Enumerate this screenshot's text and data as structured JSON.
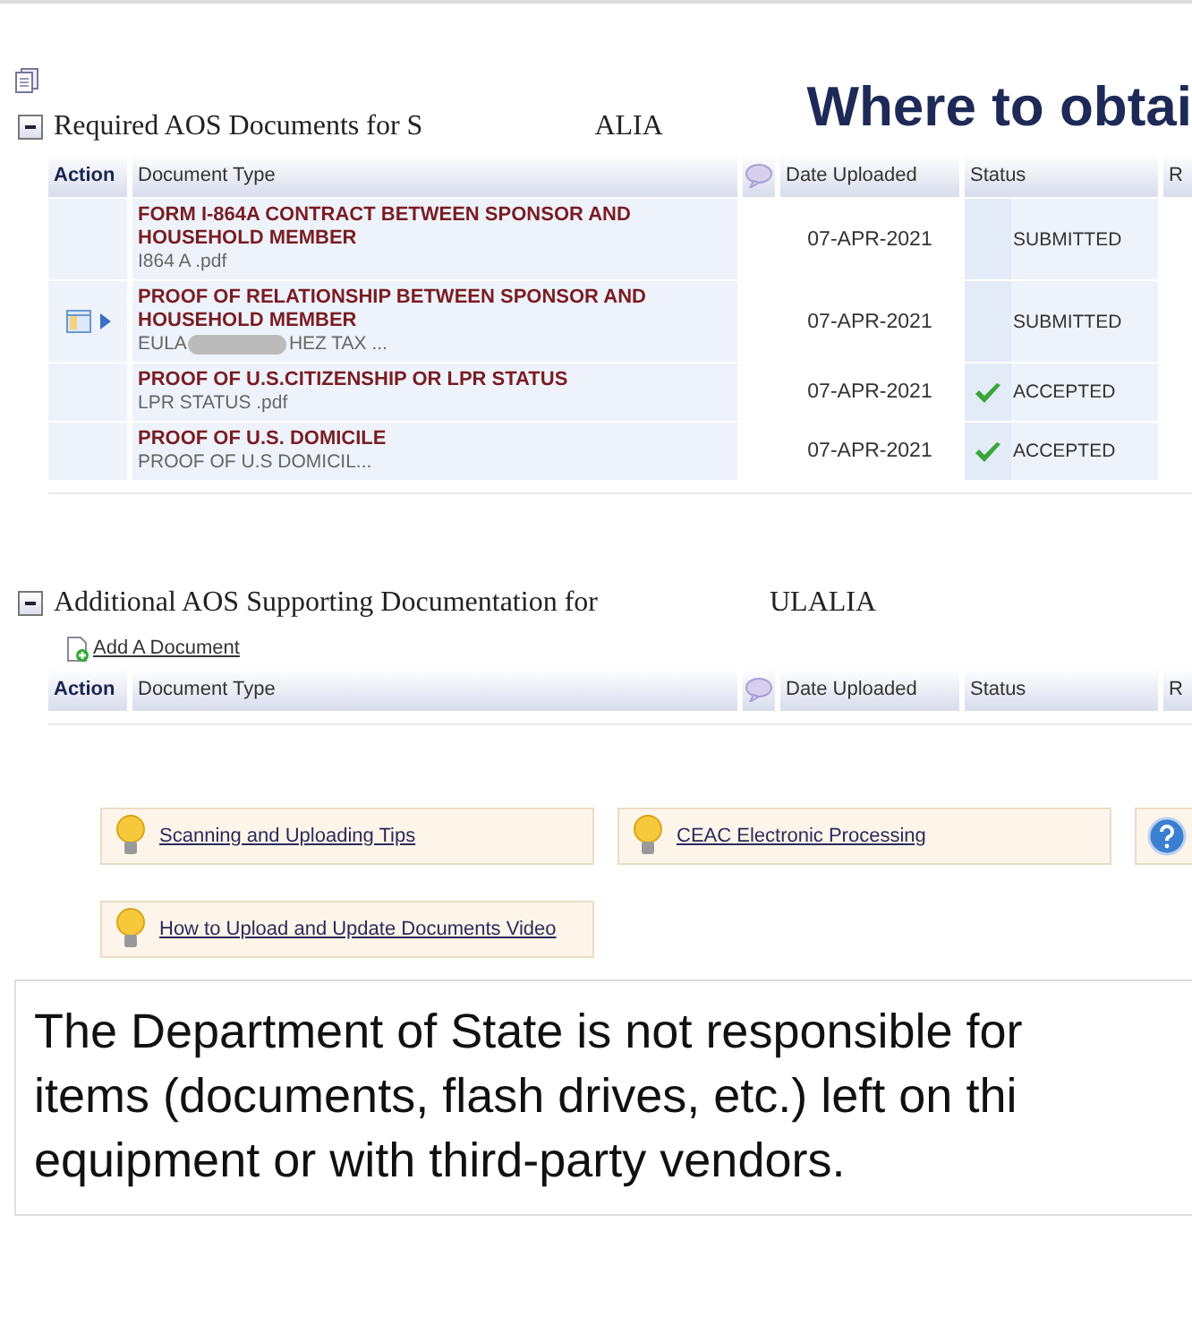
{
  "heading": "Where to obtai",
  "sections": [
    {
      "title_parts": [
        "Required AOS Documents for S",
        "ALIA"
      ],
      "expanded": true,
      "columns": [
        "Action",
        "Document Type",
        "Date Uploaded",
        "Status",
        "R"
      ],
      "rows": [
        {
          "document_type": "FORM I-864A CONTRACT BETWEEN SPONSOR AND HOUSEHOLD MEMBER",
          "file_parts": [
            "I864 A .pdf"
          ],
          "date": "07-APR-2021",
          "status": "SUBMITTED",
          "accepted": false,
          "has_actions": false
        },
        {
          "document_type": "PROOF OF RELATIONSHIP BETWEEN SPONSOR AND HOUSEHOLD MEMBER",
          "file_parts": [
            "EULA",
            "HEZ TAX ..."
          ],
          "date": "07-APR-2021",
          "status": "SUBMITTED",
          "accepted": false,
          "has_actions": true
        },
        {
          "document_type": "PROOF OF U.S.CITIZENSHIP OR LPR STATUS",
          "file_parts": [
            "LPR STATUS .pdf"
          ],
          "date": "07-APR-2021",
          "status": "ACCEPTED",
          "accepted": true,
          "has_actions": false
        },
        {
          "document_type": "PROOF OF U.S. DOMICILE",
          "file_parts": [
            "PROOF OF U.S DOMICIL..."
          ],
          "date": "07-APR-2021",
          "status": "ACCEPTED",
          "accepted": true,
          "has_actions": false
        }
      ]
    },
    {
      "title_parts": [
        "Additional AOS Supporting Documentation for",
        "ULALIA"
      ],
      "expanded": true,
      "add_link": "Add A Document",
      "columns": [
        "Action",
        "Document Type",
        "Date Uploaded",
        "Status",
        "R"
      ]
    }
  ],
  "tips": [
    {
      "kind": "tip",
      "label": "Scanning and Uploading Tips"
    },
    {
      "kind": "tip",
      "label": "CEAC Electronic Processing"
    },
    {
      "kind": "help"
    },
    {
      "kind": "tip",
      "label": "How to Upload and Update Documents Video"
    }
  ],
  "disclaimer_lines": [
    "The Department of State is not responsible for",
    "items (documents, flash drives, etc.) left on thi",
    "equipment or with third-party vendors."
  ]
}
